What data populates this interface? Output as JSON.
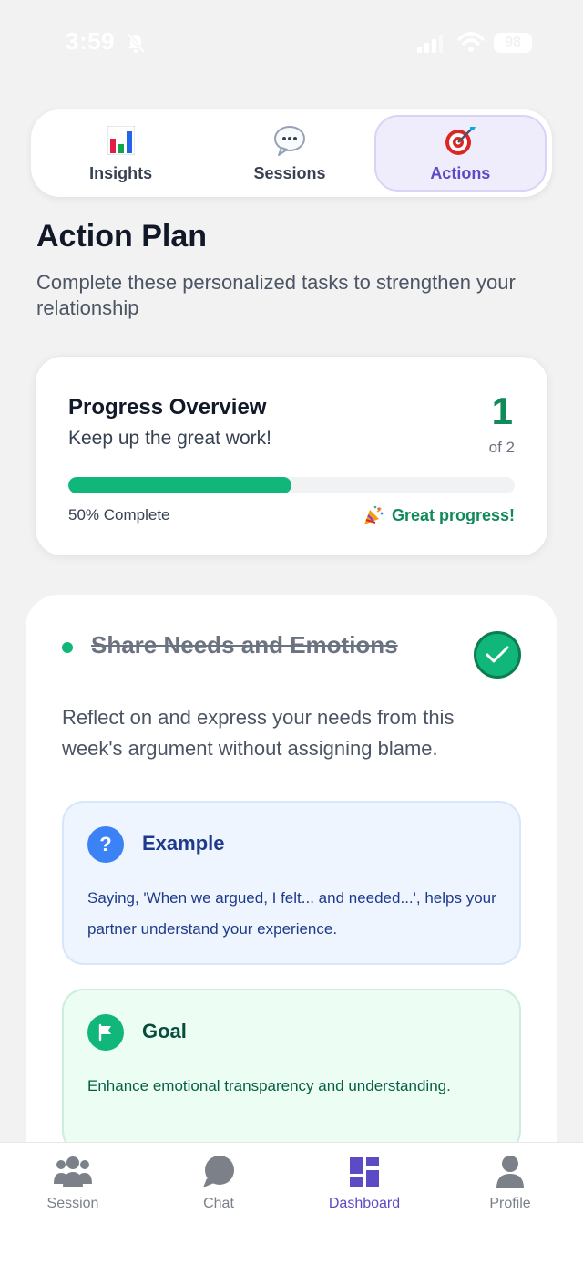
{
  "status_bar": {
    "time": "3:59",
    "battery": "98"
  },
  "tabs": [
    {
      "label": "Insights",
      "icon": "bar-chart-icon",
      "active": false
    },
    {
      "label": "Sessions",
      "icon": "speech-bubble-icon",
      "active": false
    },
    {
      "label": "Actions",
      "icon": "target-icon",
      "active": true
    }
  ],
  "header": {
    "title": "Action Plan",
    "subtitle": "Complete these personalized tasks to strengthen your relationship"
  },
  "progress": {
    "title": "Progress Overview",
    "subtitle": "Keep up the great work!",
    "completed": "1",
    "total_label": "of 2",
    "fraction": 0.5,
    "percent_label": "50% Complete",
    "encouragement": "Great progress!"
  },
  "task": {
    "title": "Share Needs and Emotions",
    "completed": true,
    "description": "Reflect on and express your needs from this week's argument without assigning blame.",
    "example": {
      "heading": "Example",
      "text": "Saying, 'When we argued, I felt... and needed...', helps your partner understand your experience."
    },
    "goal": {
      "heading": "Goal",
      "text": "Enhance emotional transparency and understanding."
    }
  },
  "bottom_nav": [
    {
      "label": "Session",
      "icon": "group-icon",
      "active": false
    },
    {
      "label": "Chat",
      "icon": "chat-bubble-icon",
      "active": false
    },
    {
      "label": "Dashboard",
      "icon": "dashboard-icon",
      "active": true
    },
    {
      "label": "Profile",
      "icon": "person-icon",
      "active": false
    }
  ],
  "colors": {
    "accent": "#5b4bc4",
    "success": "#10b67a",
    "success_dark": "#0f8a58",
    "info": "#3b82f6"
  }
}
